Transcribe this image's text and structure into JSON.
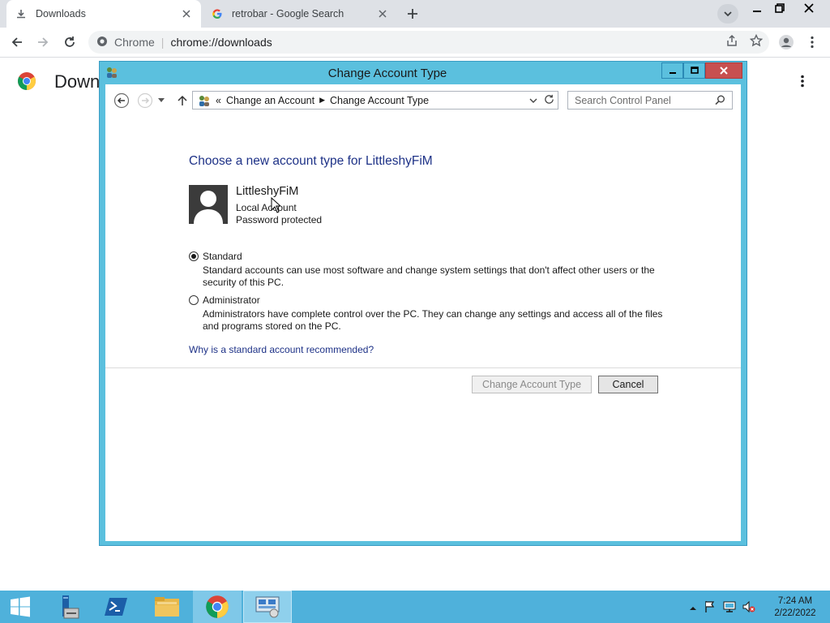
{
  "browser": {
    "tabs": [
      {
        "title": "Downloads",
        "icon": "download-icon",
        "active": true
      },
      {
        "title": "retrobar - Google Search",
        "icon": "google-icon",
        "active": false
      }
    ],
    "omnibox": {
      "site_name": "Chrome",
      "url": "chrome://downloads"
    },
    "page_title": "Down"
  },
  "dialog": {
    "title": "Change Account Type",
    "breadcrumb": {
      "prefix": "«",
      "items": [
        "Change an Account",
        "Change Account Type"
      ]
    },
    "search_placeholder": "Search Control Panel",
    "heading": "Choose a new account type for LittleshyFiM",
    "user": {
      "name": "LittleshyFiM",
      "type": "Local Account",
      "status": "Password protected"
    },
    "options": [
      {
        "label": "Standard",
        "selected": true,
        "description": "Standard accounts can use most software and change system settings that don't affect other users or the security of this PC."
      },
      {
        "label": "Administrator",
        "selected": false,
        "description": "Administrators have complete control over the PC. They can change any settings and access all of the files and programs stored on the PC."
      }
    ],
    "help_link": "Why is a standard account recommended?",
    "buttons": {
      "primary": "Change Account Type",
      "cancel": "Cancel"
    }
  },
  "taskbar": {
    "items": [
      "start-button",
      "server-manager",
      "powershell",
      "file-explorer",
      "chrome",
      "control-panel"
    ],
    "clock": {
      "time": "7:24 AM",
      "date": "2/22/2022"
    }
  },
  "colors": {
    "dialog_frame": "#5bc0de",
    "close_button": "#c75050",
    "link": "#1e3287",
    "taskbar": "#4fb1db"
  }
}
